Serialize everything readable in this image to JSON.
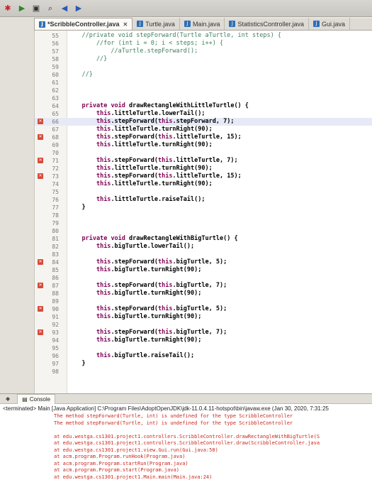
{
  "toolbar": {
    "icons": [
      "debug-icon",
      "run-icon",
      "save-icon",
      "search-icon",
      "back-icon",
      "forward-icon"
    ]
  },
  "tabs": [
    {
      "label": "*ScribbleController.java",
      "active": true
    },
    {
      "label": "Turtle.java",
      "active": false
    },
    {
      "label": "Main.java",
      "active": false
    },
    {
      "label": "StatisticsController.java",
      "active": false
    },
    {
      "label": "Gui.java",
      "active": false
    }
  ],
  "code_lines": [
    {
      "n": "55",
      "text": "    //private void stepForward(Turtle aTurtle, int steps) {",
      "type": "comment"
    },
    {
      "n": "56",
      "text": "        //for (int i = 0; i < steps; i++) {",
      "type": "comment"
    },
    {
      "n": "57",
      "text": "            //aTurtle.stepForward();",
      "type": "comment"
    },
    {
      "n": "58",
      "text": "        //}",
      "type": "comment"
    },
    {
      "n": "59",
      "text": "",
      "type": "code"
    },
    {
      "n": "60",
      "text": "    //}",
      "type": "comment"
    },
    {
      "n": "61",
      "text": "",
      "type": "code"
    },
    {
      "n": "62",
      "text": "",
      "type": "code"
    },
    {
      "n": "63",
      "text": "",
      "type": "code"
    },
    {
      "n": "64",
      "text": "    private void drawRectangleWithLittleTurtle() {",
      "type": "decl"
    },
    {
      "n": "65",
      "text": "        this.littleTurtle.lowerTail();",
      "type": "code"
    },
    {
      "n": "66",
      "text": "        this.stepForward(this.stepForward, 7);",
      "type": "code",
      "marker": true,
      "current": true
    },
    {
      "n": "67",
      "text": "        this.littleTurtle.turnRight(90);",
      "type": "code"
    },
    {
      "n": "68",
      "text": "        this.stepForward(this.littleTurtle, 15);",
      "type": "code",
      "marker": true
    },
    {
      "n": "69",
      "text": "        this.littleTurtle.turnRight(90);",
      "type": "code"
    },
    {
      "n": "70",
      "text": "",
      "type": "code"
    },
    {
      "n": "71",
      "text": "        this.stepForward(this.littleTurtle, 7);",
      "type": "code",
      "marker": true
    },
    {
      "n": "72",
      "text": "        this.littleTurtle.turnRight(90);",
      "type": "code"
    },
    {
      "n": "73",
      "text": "        this.stepForward(this.littleTurtle, 15);",
      "type": "code",
      "marker": true
    },
    {
      "n": "74",
      "text": "        this.littleTurtle.turnRight(90);",
      "type": "code"
    },
    {
      "n": "75",
      "text": "",
      "type": "code"
    },
    {
      "n": "76",
      "text": "        this.littleTurtle.raiseTail();",
      "type": "code"
    },
    {
      "n": "77",
      "text": "    }",
      "type": "code"
    },
    {
      "n": "78",
      "text": "",
      "type": "code"
    },
    {
      "n": "79",
      "text": "",
      "type": "code"
    },
    {
      "n": "80",
      "text": "",
      "type": "code"
    },
    {
      "n": "81",
      "text": "    private void drawRectangleWithBigTurtle() {",
      "type": "decl"
    },
    {
      "n": "82",
      "text": "        this.bigTurtle.lowerTail();",
      "type": "code"
    },
    {
      "n": "83",
      "text": "",
      "type": "code"
    },
    {
      "n": "84",
      "text": "        this.stepForward(this.bigTurtle, 5);",
      "type": "code",
      "marker": true
    },
    {
      "n": "85",
      "text": "        this.bigTurtle.turnRight(90);",
      "type": "code"
    },
    {
      "n": "86",
      "text": "",
      "type": "code"
    },
    {
      "n": "87",
      "text": "        this.stepForward(this.bigTurtle, 7);",
      "type": "code",
      "marker": true
    },
    {
      "n": "88",
      "text": "        this.bigTurtle.turnRight(90);",
      "type": "code"
    },
    {
      "n": "89",
      "text": "",
      "type": "code"
    },
    {
      "n": "90",
      "text": "        this.stepForward(this.bigTurtle, 5);",
      "type": "code",
      "marker": true
    },
    {
      "n": "91",
      "text": "        this.bigTurtle.turnRight(90);",
      "type": "code"
    },
    {
      "n": "92",
      "text": "",
      "type": "code"
    },
    {
      "n": "93",
      "text": "        this.stepForward(this.bigTurtle, 7);",
      "type": "code",
      "marker": true
    },
    {
      "n": "94",
      "text": "        this.bigTurtle.turnRight(90);",
      "type": "code"
    },
    {
      "n": "95",
      "text": "",
      "type": "code"
    },
    {
      "n": "96",
      "text": "        this.bigTurtle.raiseTail();",
      "type": "code"
    },
    {
      "n": "97",
      "text": "    }",
      "type": "code"
    },
    {
      "n": "98",
      "text": "",
      "type": "code"
    }
  ],
  "console": {
    "tab_label": "Console",
    "header": "<terminated> Main [Java Application] C:\\Program Files\\AdoptOpenJDK\\jdk-11.0.4.11-hotspot\\bin\\javaw.exe (Jan 30, 2020, 7:31:25",
    "errors": [
      "The method stepForward(Turtle, int) is undefined for the type ScribbleController",
      "The method stepForward(Turtle, int) is undefined for the type ScribbleController"
    ],
    "trace": [
      "at edu.westga.cs1301.project1.controllers.ScribbleController.drawRectangleWithBigTurtle(S",
      "at edu.westga.cs1301.project1.controllers.ScribbleController.draw(ScribbleController.java",
      "at edu.westga.cs1301.project1.view.Gui.run(Gui.java:58)",
      "at acm.program.Program.runHook(Program.java)",
      "at acm.program.Program.startRun(Program.java)",
      "at acm.program.Program.start(Program.java)",
      "at edu.westga.cs1301.project1.Main.main(Main.java:24)"
    ]
  }
}
